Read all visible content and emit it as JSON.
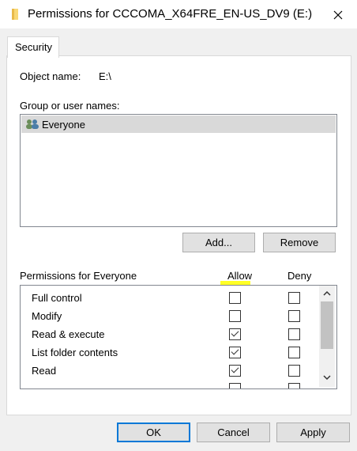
{
  "window": {
    "title": "Permissions for CCCOMA_X64FRE_EN-US_DV9 (E:)",
    "close_label": "✕"
  },
  "tabs": [
    {
      "label": "Security",
      "selected": true
    }
  ],
  "object": {
    "label": "Object name:",
    "value": "E:\\"
  },
  "groups": {
    "label": "Group or user names:",
    "items": [
      {
        "name": "Everyone",
        "selected": true
      }
    ]
  },
  "group_buttons": {
    "add": "Add...",
    "remove": "Remove"
  },
  "permissions": {
    "header": "Permissions for Everyone",
    "allow_header": "Allow",
    "deny_header": "Deny",
    "rows": [
      {
        "name": "Full control",
        "allow": false,
        "deny": false
      },
      {
        "name": "Modify",
        "allow": false,
        "deny": false
      },
      {
        "name": "Read & execute",
        "allow": true,
        "deny": false
      },
      {
        "name": "List folder contents",
        "allow": true,
        "deny": false
      },
      {
        "name": "Read",
        "allow": true,
        "deny": false
      }
    ]
  },
  "dialog_buttons": {
    "ok": "OK",
    "cancel": "Cancel",
    "apply": "Apply"
  },
  "colors": {
    "highlight": "#ffff00",
    "accent": "#0078d7",
    "selection": "#d9d9d9"
  }
}
